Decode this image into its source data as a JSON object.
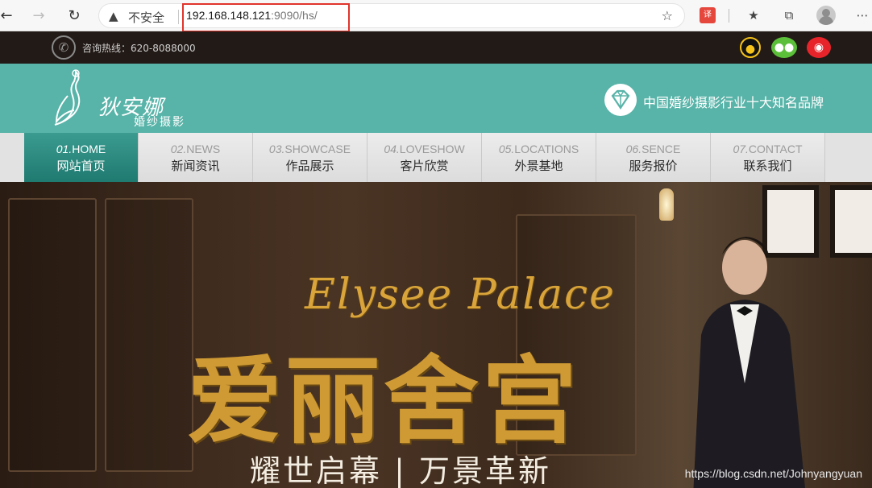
{
  "browser": {
    "insecure_label": "不安全",
    "url_host": "192.168.148.121",
    "url_rest": ":9090/hs/"
  },
  "topbar": {
    "hotline": "咨询热线：620-8088000"
  },
  "header": {
    "logo_main": "狄安娜",
    "logo_sub": "婚纱摄影",
    "slogan": "中国婚纱摄影行业十大知名品牌"
  },
  "nav": {
    "items": [
      {
        "num": "01.",
        "en": "HOME",
        "cn": "网站首页"
      },
      {
        "num": "02.",
        "en": "NEWS",
        "cn": "新闻资讯"
      },
      {
        "num": "03.",
        "en": "SHOWCASE",
        "cn": "作品展示"
      },
      {
        "num": "04.",
        "en": "LOVESHOW",
        "cn": "客片欣赏"
      },
      {
        "num": "05.",
        "en": "LOCATIONS",
        "cn": "外景基地"
      },
      {
        "num": "06.",
        "en": "SENCE",
        "cn": "服务报价"
      },
      {
        "num": "07.",
        "en": "CONTACT",
        "cn": "联系我们"
      }
    ]
  },
  "banner": {
    "script_title": "Elysee Palace",
    "title": "爱丽舍宫",
    "subtitle": "耀世启幕 | 万景革新",
    "watermark": "https://blog.csdn.net/Johnyangyuan"
  },
  "colors": {
    "accent": "#58b3a8",
    "nav_active": "#2a8a80",
    "gold": "#cf9a34",
    "url_highlight": "#e0342c"
  }
}
